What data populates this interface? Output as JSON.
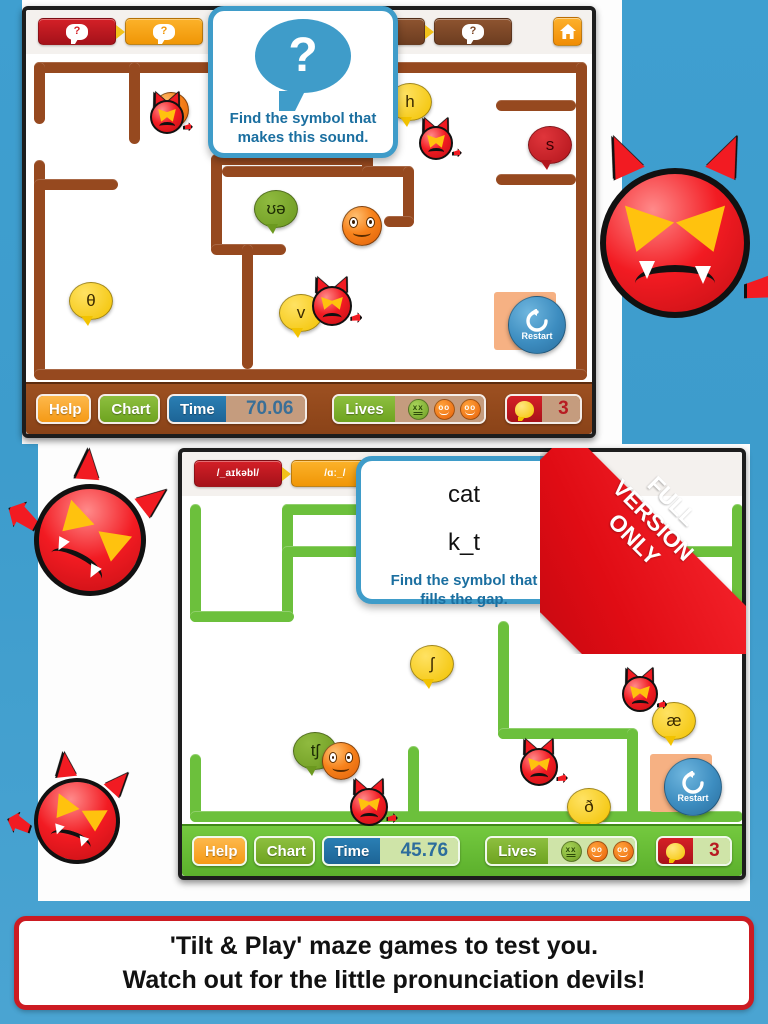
{
  "app": {
    "background_color": "#3d9ccc",
    "accent_blue": "#3f9cc9",
    "accent_red": "#cc1b22"
  },
  "game1": {
    "theme_color": "#96491f",
    "breadcrumbs": [
      {
        "label": "?",
        "style": "red",
        "icon": "question-bubble-icon"
      },
      {
        "label": "?",
        "style": "orange",
        "icon": "question-bubble-icon"
      },
      {
        "label": "?",
        "style": "brown",
        "icon": "question-bubble-icon"
      },
      {
        "label": "?",
        "style": "brown",
        "icon": "question-bubble-icon"
      }
    ],
    "home_icon": "home-icon",
    "dialog": {
      "icon": "question-speech-bubble-icon",
      "icon_glyph": "?",
      "line1": "Find the symbol that",
      "line2": "makes this sound."
    },
    "tokens": [
      {
        "symbol": "h",
        "color": "yellow"
      },
      {
        "symbol": "s",
        "color": "red"
      },
      {
        "symbol": "ʊə",
        "color": "green"
      },
      {
        "symbol": "θ",
        "color": "yellow"
      },
      {
        "symbol": "v",
        "color": "yellow"
      }
    ],
    "restart": {
      "label": "Restart",
      "icon": "refresh-icon"
    },
    "status": {
      "help_label": "Help",
      "chart_label": "Chart",
      "time_label": "Time",
      "time_value": "70.06",
      "lives_label": "Lives",
      "lives": [
        {
          "state": "dead",
          "color": "#8dbf3f"
        },
        {
          "state": "alive",
          "color": "#f7821b"
        },
        {
          "state": "alive",
          "color": "#f7821b"
        }
      ],
      "score_value": "3",
      "score_icon": "speech-blob-icon"
    }
  },
  "game2": {
    "theme_color": "#6cc03c",
    "breadcrumbs": [
      {
        "label": "/_aɪkəbl/",
        "style": "red"
      },
      {
        "label": "/ɑː_/",
        "style": "orange"
      }
    ],
    "dialog": {
      "word": "cat",
      "gap": "k_t",
      "line1": "Find the symbol that",
      "line2": "fills the gap."
    },
    "tokens": [
      {
        "symbol": "ʃ",
        "color": "yellow"
      },
      {
        "symbol": "tʃ",
        "color": "green"
      },
      {
        "symbol": "æ",
        "color": "yellow"
      },
      {
        "symbol": "ð",
        "color": "yellow"
      }
    ],
    "restart": {
      "label": "Restart",
      "icon": "refresh-icon"
    },
    "ribbon": {
      "line1": "FULL",
      "line2": "VERSION",
      "line3": "ONLY",
      "color": "#e00c14"
    },
    "status": {
      "help_label": "Help",
      "chart_label": "Chart",
      "time_label": "Time",
      "time_value": "45.76",
      "lives_label": "Lives",
      "lives": [
        {
          "state": "dead",
          "color": "#8dbf3f"
        },
        {
          "state": "alive",
          "color": "#f7821b"
        },
        {
          "state": "alive",
          "color": "#f7821b"
        }
      ],
      "score_value": "3",
      "score_icon": "speech-blob-icon"
    }
  },
  "caption": {
    "line1": "'Tilt & Play' maze games to test you.",
    "line2": "Watch out for the little pronunciation devils!"
  }
}
